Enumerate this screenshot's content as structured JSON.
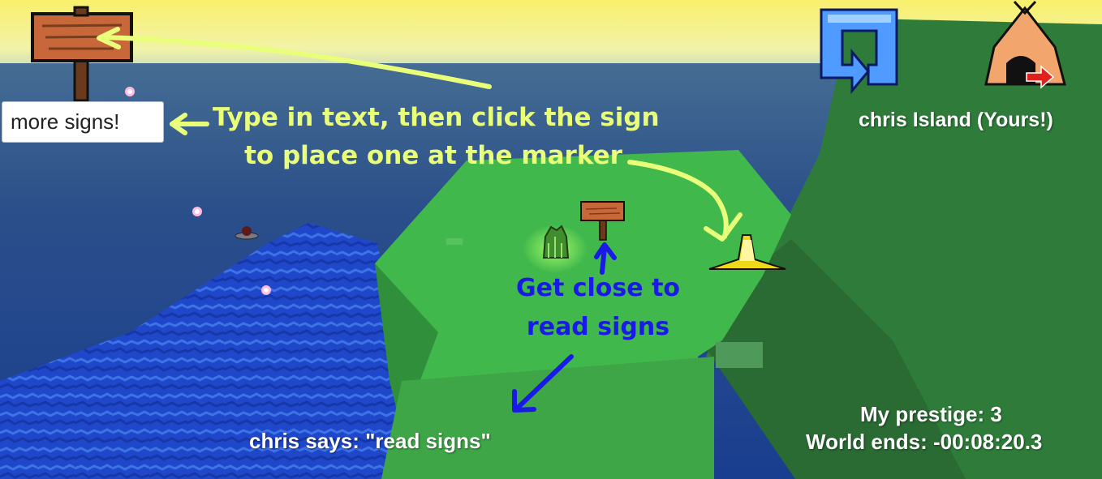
{
  "sign_input": {
    "value": "more signs!",
    "placeholder": ""
  },
  "tutorial": {
    "place_line1": "Type in text, then click the sign",
    "place_line2": "to place one at the marker",
    "read_line1": "Get close to",
    "read_line2": "read signs"
  },
  "island": {
    "name": "chris Island (Yours!)"
  },
  "chat": {
    "message": "chris says: \"read signs\""
  },
  "stats": {
    "prestige": "My prestige: 3",
    "world_ends": "World ends: -00:08:20.3"
  },
  "colors": {
    "annotation_yellow": "#e9ff7a",
    "annotation_blue": "#1a1ae6",
    "grass_light": "#42b84a",
    "grass_dark": "#2f7a3b",
    "ocean": "#1d3a9c",
    "sky": "#f4f08a",
    "sea_far": "#2e5d86"
  },
  "icons": {
    "sign_tool": "wooden-sign-icon",
    "return_button": "return-arrow-icon",
    "home_button": "home-hut-icon",
    "marker": "placement-marker-icon"
  }
}
